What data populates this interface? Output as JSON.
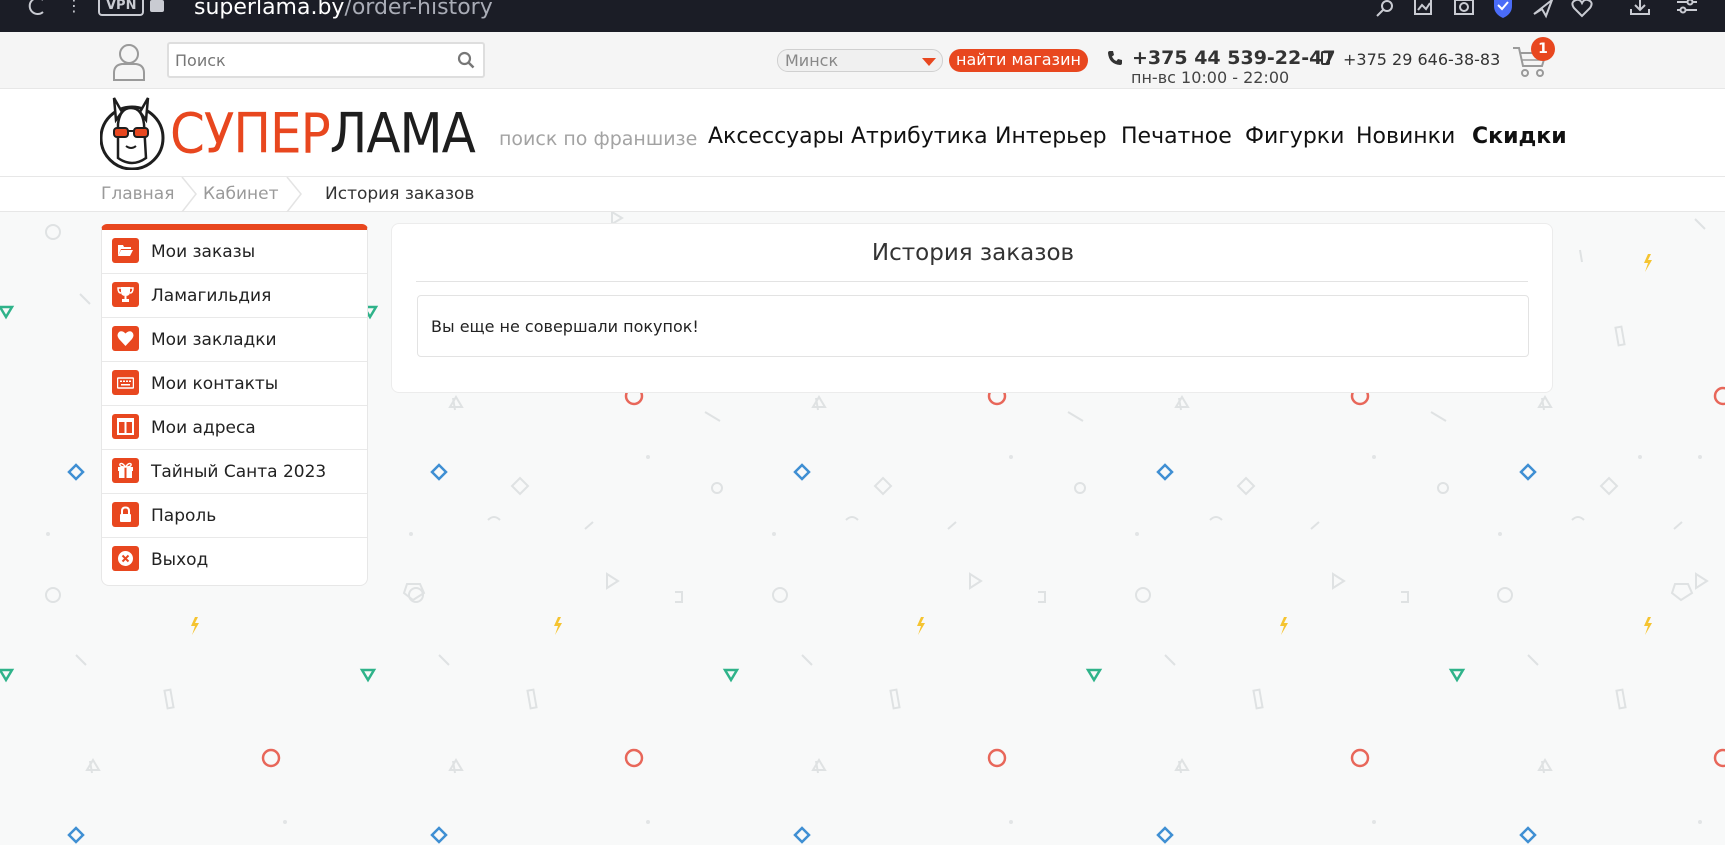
{
  "browser": {
    "vpn_label": "VPN",
    "url_domain": "superlama.by",
    "url_path": "/order-history"
  },
  "topbar": {
    "search_placeholder": "Поиск",
    "city": "Минск",
    "find_store": "найти магазин",
    "phone_main": "+375 44 539-22-47",
    "hours": "пн-вс 10:00 - 22:00",
    "phone_mobile": "+375 29 646-38-83",
    "cart_count": "1"
  },
  "brand": {
    "logo_part1": "СУПЕР",
    "logo_part2": "ЛАМА",
    "accent_color": "#e8471f"
  },
  "nav": {
    "items": [
      "поиск по франшизе",
      "Аксессуары",
      "Атрибутика",
      "Интерьер",
      "Печатное",
      "Фигурки",
      "Новинки",
      "Скидки"
    ]
  },
  "breadcrumb": {
    "items": [
      "Главная",
      "Кабинет",
      "История заказов"
    ]
  },
  "sidebar": {
    "items": [
      {
        "label": "Мои заказы",
        "icon": "folder-open-icon"
      },
      {
        "label": "Ламагильдия",
        "icon": "trophy-icon"
      },
      {
        "label": "Мои закладки",
        "icon": "heart-icon"
      },
      {
        "label": "Мои контакты",
        "icon": "keyboard-icon"
      },
      {
        "label": "Мои адреса",
        "icon": "columns-icon"
      },
      {
        "label": "Тайный Санта 2023",
        "icon": "gift-icon"
      },
      {
        "label": "Пароль",
        "icon": "lock-icon"
      },
      {
        "label": "Выход",
        "icon": "close-circle-icon"
      }
    ]
  },
  "main": {
    "title": "История заказов",
    "empty_message": "Вы еще не совершали покупок!"
  }
}
